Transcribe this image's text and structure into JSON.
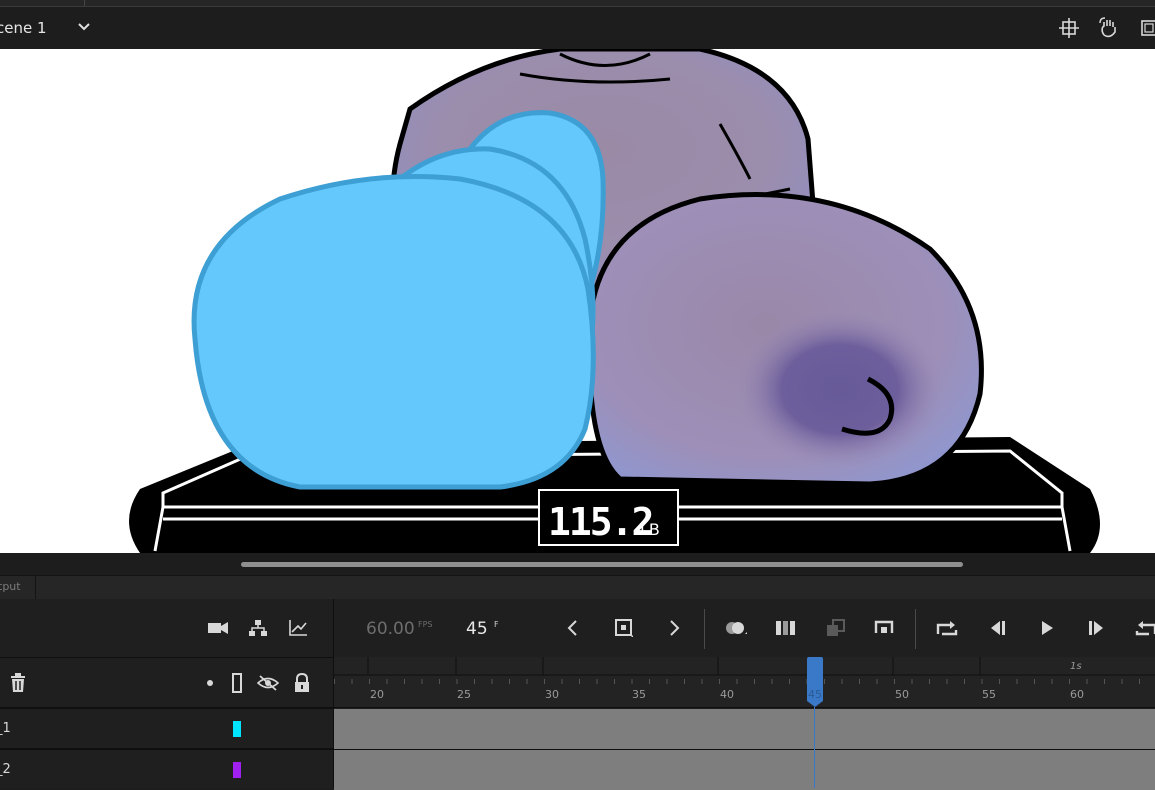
{
  "scene": {
    "name": "cene 1"
  },
  "stage": {
    "scale_display": "115.2",
    "scale_unit": "LB"
  },
  "output_tab": "tput",
  "timeline": {
    "fps_value": "60.00",
    "fps_unit": "FPS",
    "current_frame": "45",
    "frame_unit": "F",
    "ruler_labels": [
      "20",
      "25",
      "30",
      "35",
      "40",
      "45",
      "50",
      "55",
      "60"
    ],
    "ruler_second": "1s",
    "layers": [
      {
        "name": "_1",
        "color": "#00e5ff"
      },
      {
        "name": "_2",
        "color": "#a020f0"
      }
    ]
  }
}
